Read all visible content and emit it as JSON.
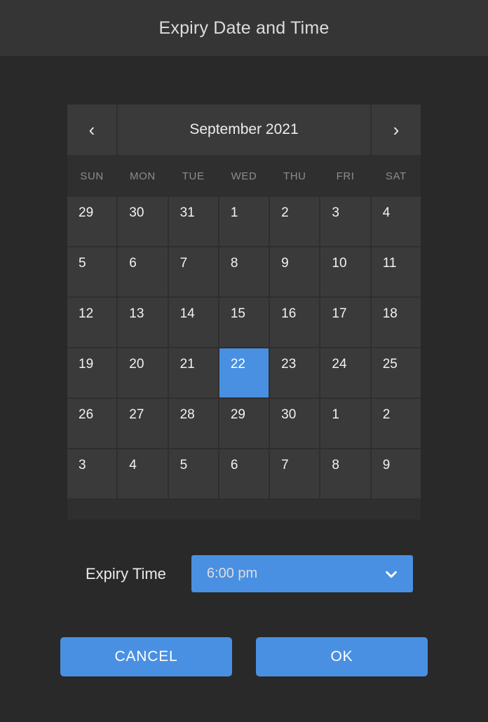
{
  "dialog": {
    "title": "Expiry Date and Time"
  },
  "calendar": {
    "prev_label": "‹",
    "next_label": "›",
    "month_title": "September 2021",
    "weekdays": [
      "SUN",
      "MON",
      "TUE",
      "WED",
      "THU",
      "FRI",
      "SAT"
    ],
    "days": [
      {
        "label": "29",
        "selected": false
      },
      {
        "label": "30",
        "selected": false
      },
      {
        "label": "31",
        "selected": false
      },
      {
        "label": "1",
        "selected": false
      },
      {
        "label": "2",
        "selected": false
      },
      {
        "label": "3",
        "selected": false
      },
      {
        "label": "4",
        "selected": false
      },
      {
        "label": "5",
        "selected": false
      },
      {
        "label": "6",
        "selected": false
      },
      {
        "label": "7",
        "selected": false
      },
      {
        "label": "8",
        "selected": false
      },
      {
        "label": "9",
        "selected": false
      },
      {
        "label": "10",
        "selected": false
      },
      {
        "label": "11",
        "selected": false
      },
      {
        "label": "12",
        "selected": false
      },
      {
        "label": "13",
        "selected": false
      },
      {
        "label": "14",
        "selected": false
      },
      {
        "label": "15",
        "selected": false
      },
      {
        "label": "16",
        "selected": false
      },
      {
        "label": "17",
        "selected": false
      },
      {
        "label": "18",
        "selected": false
      },
      {
        "label": "19",
        "selected": false
      },
      {
        "label": "20",
        "selected": false
      },
      {
        "label": "21",
        "selected": false
      },
      {
        "label": "22",
        "selected": true
      },
      {
        "label": "23",
        "selected": false
      },
      {
        "label": "24",
        "selected": false
      },
      {
        "label": "25",
        "selected": false
      },
      {
        "label": "26",
        "selected": false
      },
      {
        "label": "27",
        "selected": false
      },
      {
        "label": "28",
        "selected": false
      },
      {
        "label": "29",
        "selected": false
      },
      {
        "label": "30",
        "selected": false
      },
      {
        "label": "1",
        "selected": false
      },
      {
        "label": "2",
        "selected": false
      },
      {
        "label": "3",
        "selected": false
      },
      {
        "label": "4",
        "selected": false
      },
      {
        "label": "5",
        "selected": false
      },
      {
        "label": "6",
        "selected": false
      },
      {
        "label": "7",
        "selected": false
      },
      {
        "label": "8",
        "selected": false
      },
      {
        "label": "9",
        "selected": false
      }
    ]
  },
  "time": {
    "label": "Expiry Time",
    "value": "6:00 pm",
    "dropdown_icon": "chevron-down-icon"
  },
  "actions": {
    "cancel_label": "CANCEL",
    "ok_label": "OK"
  },
  "colors": {
    "accent": "#4a90e2",
    "page_background": "#292929",
    "header_background": "#353535",
    "calendar_background": "#2f2f2f",
    "day_tile": "#3a3a3a"
  }
}
